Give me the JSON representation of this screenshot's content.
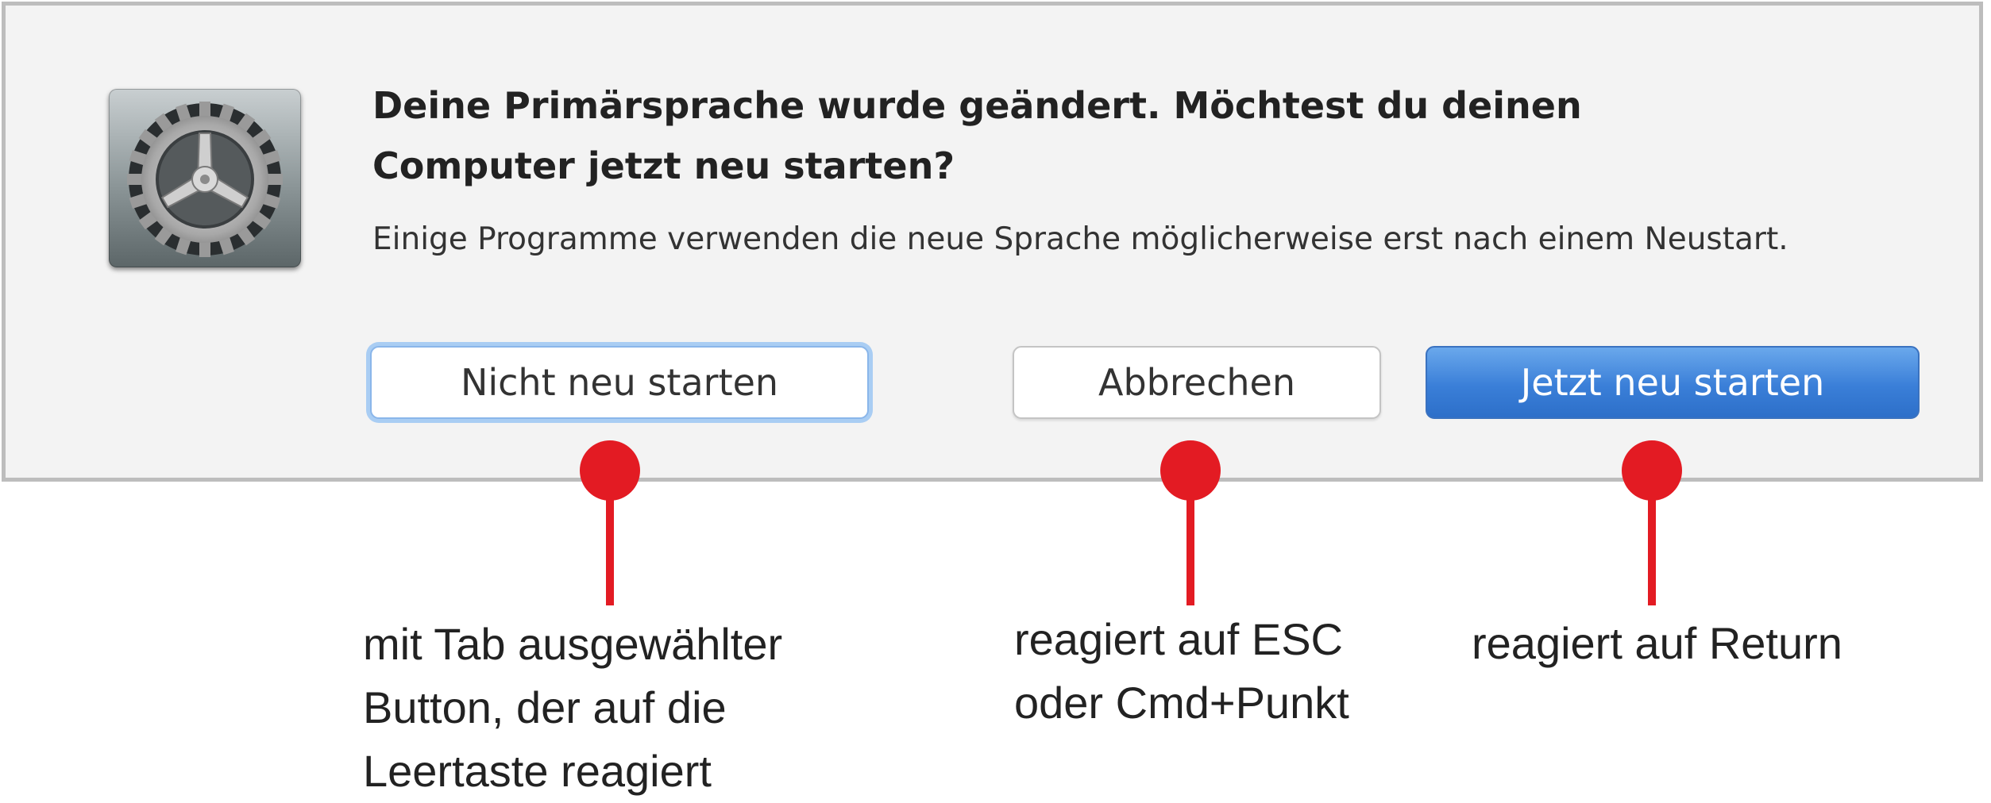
{
  "dialog": {
    "icon": "system-preferences-gear-icon",
    "title": "Deine Primärsprache wurde geändert. Möchtest du deinen Computer jetzt neu starten?",
    "message": "Einige Programme verwenden die neue Sprache möglicherweise erst nach einem Neustart.",
    "buttons": {
      "skip_label": "Nicht neu starten",
      "cancel_label": "Abbrechen",
      "restart_label": "Jetzt neu starten"
    }
  },
  "annotations": {
    "skip": "mit Tab ausgewählter\nButton, der auf die\nLeertaste reagiert",
    "cancel": "reagiert auf ESC\noder Cmd+Punkt",
    "restart": "reagiert auf Return"
  },
  "colors": {
    "marker": "#e31b23",
    "default_button": "#3a7fd8",
    "focus_ring": "#a9cdf3",
    "dialog_background": "#f3f3f3"
  }
}
